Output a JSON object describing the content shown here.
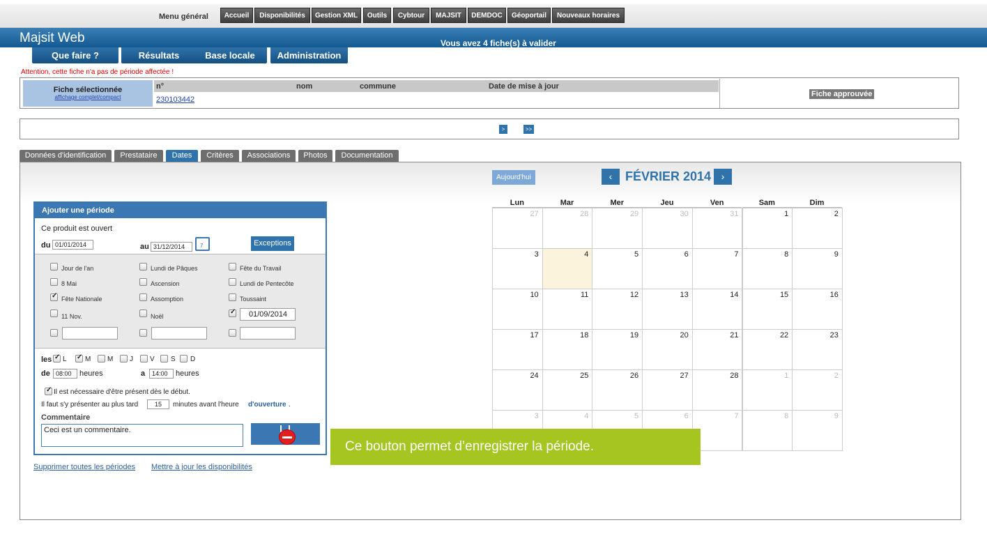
{
  "topmenu": {
    "label": "Menu général",
    "items": [
      "Accueil",
      "Disponibilités",
      "Gestion XML",
      "Outils",
      "Cybtour",
      "MAJSIT",
      "DEMDOC",
      "Géoportail",
      "Nouveaux horaires"
    ]
  },
  "app": {
    "title": "Majsit Web",
    "notice": "Vous avez 4 fiche(s) à valider"
  },
  "nav": [
    "Que faire ?",
    "Résultats",
    "Base locale",
    "Administration"
  ],
  "warning": "Attention, cette fiche n'a pas de période affectée !",
  "fiche": {
    "selected_title": "Fiche sélectionnée",
    "toggle_link": "affichage complet/compact",
    "headers": {
      "num": "n°",
      "nom": "nom",
      "commune": "commune",
      "date": "Date de mise à jour"
    },
    "num_value": "230103442",
    "status": "Fiche approuvée"
  },
  "pager": {
    "next": ">",
    "last": ">>"
  },
  "tabs": [
    "Données d'identification",
    "Prestataire",
    "Dates",
    "Critères",
    "Associations",
    "Photos",
    "Documentation"
  ],
  "period": {
    "title": "Ajouter une période",
    "open_text": "Ce produit est ouvert",
    "du_label": "du",
    "du_value": "01/01/2014",
    "au_label": "au",
    "au_value": "31/12/2014",
    "calendar_day": "7",
    "exceptions_label": "Exceptions",
    "holidays": [
      {
        "label": "Jour de l'an",
        "checked": false
      },
      {
        "label": "Lundi de Pâques",
        "checked": false
      },
      {
        "label": "Fête du Travail",
        "checked": false
      },
      {
        "label": "8 Mai",
        "checked": false
      },
      {
        "label": "Ascension",
        "checked": false
      },
      {
        "label": "Lundi de Pentecôte",
        "checked": false
      },
      {
        "label": "Fête Nationale",
        "checked": true
      },
      {
        "label": "Assomption",
        "checked": false
      },
      {
        "label": "Toussaint",
        "checked": false
      },
      {
        "label": "11 Nov.",
        "checked": false
      },
      {
        "label": "Noël",
        "checked": false
      }
    ],
    "custom_date": "01/09/2014",
    "les_label": "les",
    "days": [
      {
        "label": "L",
        "checked": true
      },
      {
        "label": "M",
        "checked": true
      },
      {
        "label": "M",
        "checked": false
      },
      {
        "label": "J",
        "checked": false
      },
      {
        "label": "V",
        "checked": false
      },
      {
        "label": "S",
        "checked": false
      },
      {
        "label": "D",
        "checked": false
      }
    ],
    "de_label": "de",
    "from_time": "08:00",
    "heures": "heures",
    "a_label": "a",
    "to_time": "14:00",
    "presence_text": "Il est nécessaire d'être présent dès le début.",
    "late_before": "Il faut s'y présenter au plus tard",
    "late_minutes": "15",
    "late_after": "minutes avant l'heure",
    "late_link": "d'ouverture",
    "late_end": ".",
    "comment_label": "Commentaire",
    "comment_value": "Ceci est un commentaire."
  },
  "footer_links": [
    "Supprimer toutes les périodes",
    "Mettre à jour les disponibilités"
  ],
  "tooltip": "Ce bouton permet d’enregistrer la période.",
  "calendar": {
    "today_label": "Aujourd'hui",
    "prev": "‹",
    "next": "›",
    "month": "FÉVRIER 2014",
    "weekdays": [
      "Lun",
      "Mar",
      "Mer",
      "Jeu",
      "Ven",
      "Sam",
      "Dim"
    ],
    "weeks": [
      [
        {
          "d": "27",
          "o": true
        },
        {
          "d": "28",
          "o": true
        },
        {
          "d": "29",
          "o": true
        },
        {
          "d": "30",
          "o": true
        },
        {
          "d": "31",
          "o": true
        },
        {
          "d": "1",
          "o": false
        },
        {
          "d": "2",
          "o": false
        }
      ],
      [
        {
          "d": "3",
          "o": false
        },
        {
          "d": "4",
          "o": false,
          "t": true
        },
        {
          "d": "5",
          "o": false
        },
        {
          "d": "6",
          "o": false
        },
        {
          "d": "7",
          "o": false
        },
        {
          "d": "8",
          "o": false
        },
        {
          "d": "9",
          "o": false
        }
      ],
      [
        {
          "d": "10",
          "o": false
        },
        {
          "d": "11",
          "o": false
        },
        {
          "d": "12",
          "o": false
        },
        {
          "d": "13",
          "o": false
        },
        {
          "d": "14",
          "o": false
        },
        {
          "d": "15",
          "o": false
        },
        {
          "d": "16",
          "o": false
        }
      ],
      [
        {
          "d": "17",
          "o": false
        },
        {
          "d": "18",
          "o": false
        },
        {
          "d": "19",
          "o": false
        },
        {
          "d": "20",
          "o": false
        },
        {
          "d": "21",
          "o": false
        },
        {
          "d": "22",
          "o": false
        },
        {
          "d": "23",
          "o": false
        }
      ],
      [
        {
          "d": "24",
          "o": false
        },
        {
          "d": "25",
          "o": false
        },
        {
          "d": "26",
          "o": false
        },
        {
          "d": "27",
          "o": false
        },
        {
          "d": "28",
          "o": false
        },
        {
          "d": "1",
          "o": true
        },
        {
          "d": "2",
          "o": true
        }
      ],
      [
        {
          "d": "3",
          "o": true
        },
        {
          "d": "4",
          "o": true
        },
        {
          "d": "5",
          "o": true
        },
        {
          "d": "6",
          "o": true
        },
        {
          "d": "7",
          "o": true
        },
        {
          "d": "8",
          "o": true
        },
        {
          "d": "9",
          "o": true
        }
      ]
    ]
  },
  "colors": {
    "accent": "#2f73aa",
    "tooltip": "#a7c520",
    "warning": "#e00000",
    "today": "#fbf3dc"
  }
}
